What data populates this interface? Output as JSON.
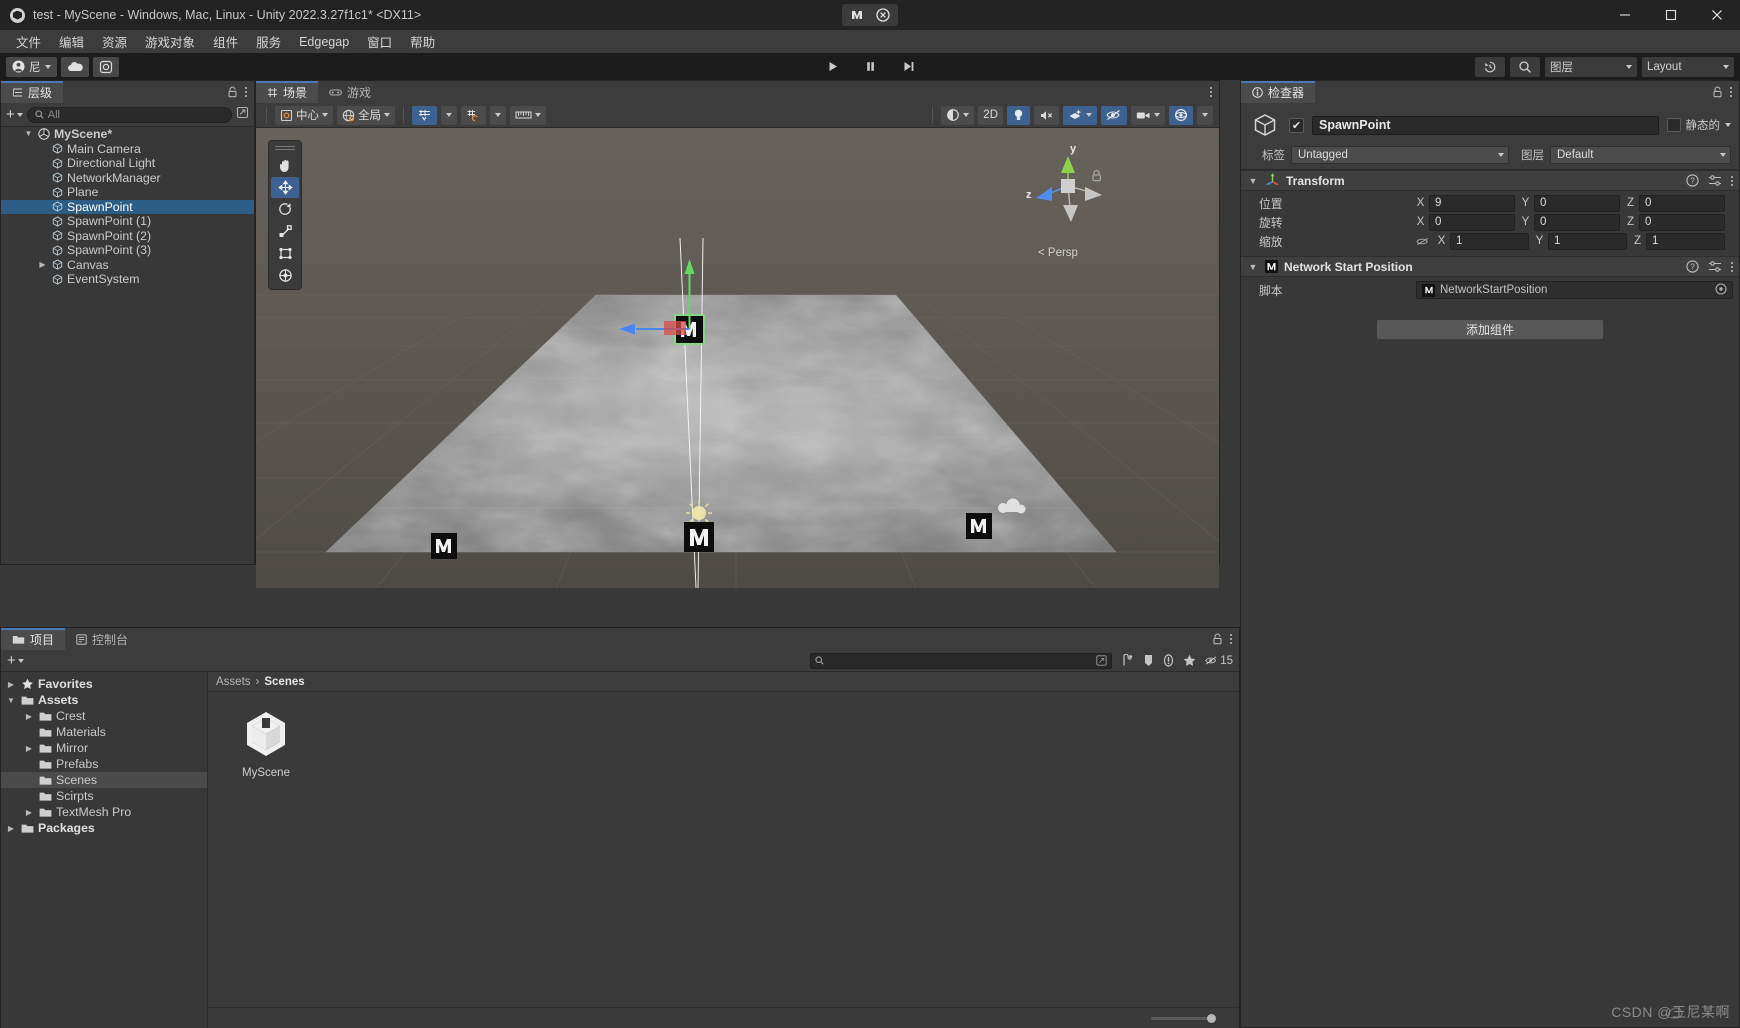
{
  "window": {
    "title": "test - MyScene - Windows, Mac, Linux - Unity 2022.3.27f1c1* <DX11>",
    "minimize": "–",
    "maximize": "☐",
    "close": "✕"
  },
  "menubar": {
    "items": [
      "文件",
      "编辑",
      "资源",
      "游戏对象",
      "组件",
      "服务",
      "Edgegap",
      "窗口",
      "帮助"
    ]
  },
  "toolbar": {
    "account_label": "尼",
    "cloud_icon": "cloud-icon",
    "settings_icon": "gear-icon",
    "play_icon": "play-icon",
    "pause_icon": "pause-icon",
    "step_icon": "step-icon",
    "history_icon": "history-icon",
    "search_icon": "search-icon",
    "layers_label": "图层",
    "layout_label": "Layout"
  },
  "hierarchy": {
    "tab_label": "层级",
    "search_placeholder": "All",
    "add_label": "+",
    "items": [
      {
        "label": "MyScene*",
        "depth": 0,
        "type": "scene",
        "expanded": true,
        "selected": false
      },
      {
        "label": "Main Camera",
        "depth": 1,
        "type": "gameobject",
        "expanded": null,
        "selected": false
      },
      {
        "label": "Directional Light",
        "depth": 1,
        "type": "gameobject",
        "expanded": null,
        "selected": false
      },
      {
        "label": "NetworkManager",
        "depth": 1,
        "type": "gameobject",
        "expanded": null,
        "selected": false
      },
      {
        "label": "Plane",
        "depth": 1,
        "type": "gameobject",
        "expanded": null,
        "selected": false
      },
      {
        "label": "SpawnPoint",
        "depth": 1,
        "type": "gameobject",
        "expanded": null,
        "selected": true
      },
      {
        "label": "SpawnPoint (1)",
        "depth": 1,
        "type": "gameobject",
        "expanded": null,
        "selected": false
      },
      {
        "label": "SpawnPoint (2)",
        "depth": 1,
        "type": "gameobject",
        "expanded": null,
        "selected": false
      },
      {
        "label": "SpawnPoint (3)",
        "depth": 1,
        "type": "gameobject",
        "expanded": null,
        "selected": false
      },
      {
        "label": "Canvas",
        "depth": 1,
        "type": "gameobject",
        "expanded": false,
        "selected": false
      },
      {
        "label": "EventSystem",
        "depth": 1,
        "type": "gameobject",
        "expanded": null,
        "selected": false
      }
    ]
  },
  "scene": {
    "tabs": [
      {
        "label": "场景",
        "icon": "grid-icon",
        "active": true
      },
      {
        "label": "游戏",
        "icon": "gamepad-icon",
        "active": false
      }
    ],
    "pivot_label": "中心",
    "space_label": "全局",
    "grid_snap_icon": "grid-snap-icon",
    "snap_increment_icon": "snap-increment-icon",
    "ruler_icon": "ruler-icon",
    "shading_icon": "shading-mode-icon",
    "mode_2d": "2D",
    "light_icon": "lighting-icon",
    "audio_icon": "audio-mute-icon",
    "fx_icon": "effects-icon",
    "visibility_icon": "scene-visibility-icon",
    "camera_icon": "scene-camera-icon",
    "gizmos_icon": "gizmos-icon",
    "gizmo_axes": {
      "y": "y",
      "z": "z",
      "persp": "< Persp"
    },
    "tools": [
      "hand-tool",
      "move-tool",
      "rotate-tool",
      "scale-tool",
      "rect-tool",
      "transform-tool"
    ]
  },
  "inspector": {
    "tab_label": "检查器",
    "object_name": "SpawnPoint",
    "enabled": true,
    "static_label": "静态的",
    "tag_label": "标签",
    "tag_value": "Untagged",
    "layer_label": "图层",
    "layer_value": "Default",
    "components": [
      {
        "title": "Transform",
        "icon": "transform-icon",
        "rows": [
          {
            "label": "位置",
            "x": "9",
            "y": "0",
            "z": "0",
            "link": false
          },
          {
            "label": "旋转",
            "x": "0",
            "y": "0",
            "z": "0",
            "link": false
          },
          {
            "label": "缩放",
            "x": "1",
            "y": "1",
            "z": "1",
            "link": true
          }
        ]
      }
    ],
    "network_component": {
      "title": "Network Start Position",
      "icon": "mirror-icon",
      "script_label": "脚本",
      "script_value": "NetworkStartPosition",
      "enabled": true
    },
    "add_component_label": "添加组件"
  },
  "project": {
    "tabs": [
      {
        "label": "项目",
        "icon": "folder-icon",
        "active": true
      },
      {
        "label": "控制台",
        "icon": "console-icon",
        "active": false
      }
    ],
    "add_label": "+",
    "search_placeholder": "",
    "count_badge": "15",
    "breadcrumb": [
      "Assets",
      "Scenes"
    ],
    "tree": [
      {
        "label": "Favorites",
        "depth": 0,
        "type": "star",
        "expanded": false,
        "bold": true,
        "selected": false
      },
      {
        "label": "Assets",
        "depth": 0,
        "type": "folder-open",
        "expanded": true,
        "bold": true,
        "selected": false
      },
      {
        "label": "Crest",
        "depth": 1,
        "type": "folder",
        "expanded": false,
        "bold": false,
        "selected": false
      },
      {
        "label": "Materials",
        "depth": 1,
        "type": "folder",
        "expanded": null,
        "bold": false,
        "selected": false
      },
      {
        "label": "Mirror",
        "depth": 1,
        "type": "folder",
        "expanded": false,
        "bold": false,
        "selected": false
      },
      {
        "label": "Prefabs",
        "depth": 1,
        "type": "folder",
        "expanded": null,
        "bold": false,
        "selected": false
      },
      {
        "label": "Scenes",
        "depth": 1,
        "type": "folder",
        "expanded": null,
        "bold": false,
        "selected": true
      },
      {
        "label": "Scirpts",
        "depth": 1,
        "type": "folder",
        "expanded": null,
        "bold": false,
        "selected": false
      },
      {
        "label": "TextMesh Pro",
        "depth": 1,
        "type": "folder",
        "expanded": false,
        "bold": false,
        "selected": false
      },
      {
        "label": "Packages",
        "depth": 0,
        "type": "folder-open",
        "expanded": false,
        "bold": true,
        "selected": false
      }
    ],
    "assets": [
      {
        "label": "MyScene",
        "icon": "unity-scene-icon"
      }
    ]
  },
  "watermark": "CSDN @王尼某啊",
  "colors": {
    "accent_blue": "#3d6291",
    "selection_blue": "#2c5d87",
    "panel_bg": "#383838",
    "toolbar_bg": "#3c3c3c",
    "titlebar_bg": "#232323"
  }
}
